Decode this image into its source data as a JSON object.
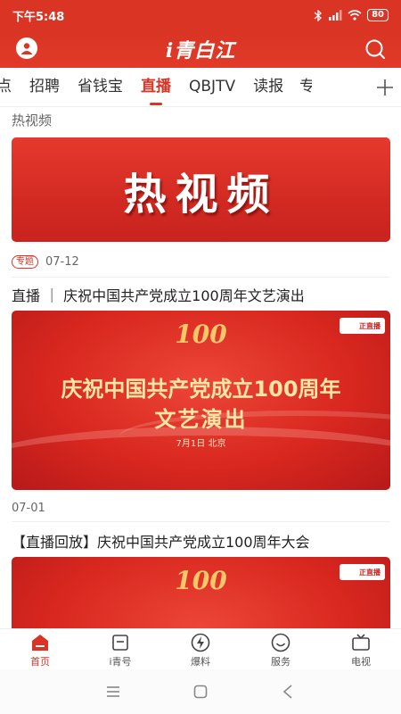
{
  "status": {
    "time": "下午5:48",
    "battery": "80"
  },
  "app": {
    "logo": "i青白江"
  },
  "tabs": [
    {
      "label": "点",
      "active": false
    },
    {
      "label": "招聘",
      "active": false
    },
    {
      "label": "省钱宝",
      "active": false
    },
    {
      "label": "直播",
      "active": true
    },
    {
      "label": "QBJTV",
      "active": false
    },
    {
      "label": "读报",
      "active": false
    },
    {
      "label": "专",
      "active": false
    }
  ],
  "section": {
    "title": "热视频"
  },
  "banner": {
    "text": "热视频"
  },
  "item1": {
    "tag": "专题",
    "date": "07-12"
  },
  "item2": {
    "headline": "直播 ｜ 庆祝中国共产党成立100周年文艺演出",
    "hero_badge": "100",
    "hero_line1": "庆祝中国共产党成立100周年",
    "hero_line2": "文艺演出",
    "hero_sub": "7月1日 北京",
    "live_badge": "正直播",
    "date": "07-01"
  },
  "item3": {
    "headline": "【直播回放】庆祝中国共产党成立100周年大会",
    "hero_badge": "100",
    "live_badge": "正直播"
  },
  "tabbar": [
    {
      "label": "首页",
      "icon": "home-icon",
      "active": true
    },
    {
      "label": "i青号",
      "icon": "bookmark-icon",
      "active": false
    },
    {
      "label": "爆料",
      "icon": "lightning-icon",
      "active": false
    },
    {
      "label": "服务",
      "icon": "smile-icon",
      "active": false
    },
    {
      "label": "电视",
      "icon": "tv-icon",
      "active": false
    }
  ],
  "colors": {
    "brand": "#d93424",
    "text": "#222222",
    "muted": "#666666",
    "gold": "#ffe6a5"
  }
}
